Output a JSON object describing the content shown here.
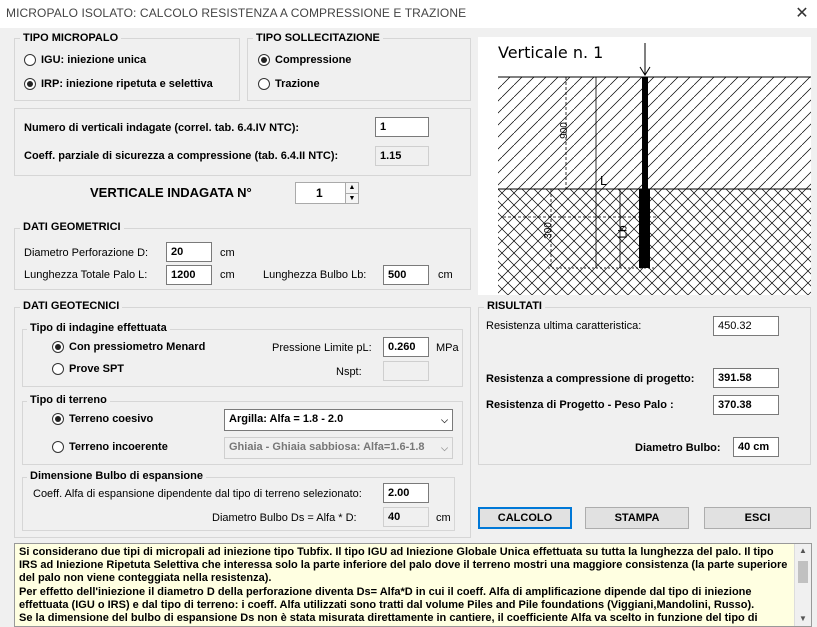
{
  "window": {
    "title": "MICROPALO ISOLATO: CALCOLO RESISTENZA A COMPRESSIONE E TRAZIONE",
    "close_glyph": "✕"
  },
  "tipo_micropalo": {
    "title": "TIPO MICROPALO",
    "options": [
      {
        "label": "IGU: iniezione unica",
        "selected": false
      },
      {
        "label": "IRP: iniezione ripetuta e selettiva",
        "selected": true
      }
    ]
  },
  "tipo_sollecitazione": {
    "title": "TIPO SOLLECITAZIONE",
    "options": [
      {
        "label": "Compressione",
        "selected": true
      },
      {
        "label": "Trazione",
        "selected": false
      }
    ]
  },
  "verticali": {
    "num_label": "Numero di verticali indagate (correl. tab. 6.4.IV NTC):",
    "num_value": "1",
    "coeff_label": "Coeff. parziale di sicurezza a compressione (tab. 6.4.II NTC):",
    "coeff_value": "1.15"
  },
  "verticale_indagata": {
    "label": "VERTICALE INDAGATA  N°",
    "value": "1",
    "up_glyph": "▲",
    "down_glyph": "▼"
  },
  "dati_geometrici": {
    "title": "DATI  GEOMETRICI",
    "diametro_label": "Diametro Perforazione  D:",
    "diametro_value": "20",
    "diametro_unit": "cm",
    "lunghezza_label": "Lunghezza Totale Palo  L:",
    "lunghezza_value": "1200",
    "lunghezza_unit": "cm",
    "bulbo_label": "Lunghezza Bulbo  Lb:",
    "bulbo_value": "500",
    "bulbo_unit": "cm"
  },
  "dati_geotecnici": {
    "title": "DATI GEOTECNICI",
    "indagine_title": "Tipo di indagine effettuata",
    "indagine_options": [
      {
        "label": "Con pressiometro Menard",
        "selected": true
      },
      {
        "label": "Prove  SPT",
        "selected": false
      }
    ],
    "pressione_label": "Pressione Limite  pL:",
    "pressione_value": "0.260",
    "pressione_unit": "MPa",
    "nspt_label": "Nspt:",
    "nspt_value": "",
    "terreno_title": "Tipo di terreno",
    "terreno_options": [
      {
        "label": "Terreno coesivo",
        "selected": true
      },
      {
        "label": "Terreno incoerente",
        "selected": false
      }
    ],
    "coesivo_select": "Argilla: Alfa = 1.8 - 2.0",
    "incoerente_select": "Ghiaia - Ghiaia sabbiosa: Alfa=1.6-1.8",
    "bulbo_title": "Dimensione Bulbo di espansione",
    "alfa_label": "Coeff. Alfa di espansione dipendente dal tipo di terreno selezionato:",
    "alfa_value": "2.00",
    "ds_label": "Diametro Bulbo Ds = Alfa * D:",
    "ds_value": "40",
    "ds_unit": "cm"
  },
  "diagram": {
    "title": "Verticale n.  1",
    "label_L": "L",
    "label_Lb": "Lb",
    "label_top": "900",
    "label_bottom": "300"
  },
  "risultati": {
    "title": "RISULTATI",
    "res_ult_label": "Resistenza ultima caratteristica:",
    "res_ult_value": "450.32",
    "res_comp_label": "Resistenza a compressione di progetto:",
    "res_comp_value": "391.58",
    "res_peso_label": "Resistenza  di Progetto - Peso Palo :",
    "res_peso_value": "370.38",
    "diam_label": "Diametro Bulbo:",
    "diam_value": "40 cm"
  },
  "buttons": {
    "calcolo": "CALCOLO",
    "stampa": "STAMPA",
    "esci": "ESCI"
  },
  "info": {
    "p1": "Si considerano due tipi di micropali ad iniezione tipo Tubfix. Il tipo IGU ad Iniezione Globale Unica effettuata su tutta la lunghezza del palo. Il tipo IRS ad Iniezione Ripetuta Selettiva che interessa solo la parte inferiore del palo dove il terreno mostri una maggiore consistenza (la parte superiore del palo non viene conteggiata nella resistenza).",
    "p2": "Per effetto dell'iniezione il diametro D della perforazione diventa Ds= Alfa*D in cui il coeff. Alfa di amplificazione dipende dal tipo di iniezione effettuata (IGU o IRS) e dal tipo di terreno: i coeff. Alfa utilizzati sono tratti dal volume Piles and Pile foundations (Viggiani,Mandolini, Russo).",
    "p3": "Se la dimensione del bulbo di espansione Ds non è stata misurata direttamente in cantiere, il coefficiente Alfa va scelto in funzione del tipo di terreno attraversato dal bulbo."
  }
}
